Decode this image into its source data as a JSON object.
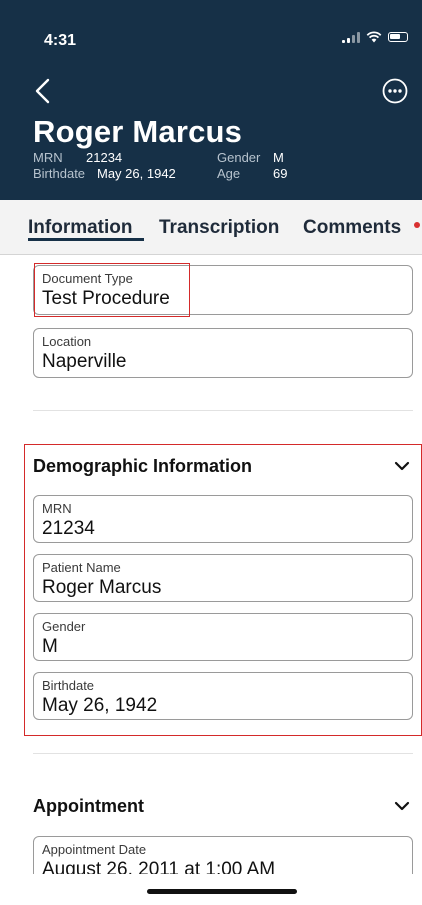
{
  "status_bar": {
    "time": "4:31"
  },
  "header": {
    "patient_name": "Roger Marcus",
    "mrn_label": "MRN",
    "mrn_value": "21234",
    "gender_label": "Gender",
    "gender_value": "M",
    "birthdate_label": "Birthdate",
    "birthdate_value": "May 26, 1942",
    "age_label": "Age",
    "age_value": "69"
  },
  "tabs": [
    {
      "label": "Information",
      "selected": true
    },
    {
      "label": "Transcription",
      "selected": false
    },
    {
      "label": "Comments",
      "selected": false,
      "badge": true
    }
  ],
  "fields_top": [
    {
      "label": "Document Type",
      "value": "Test Procedure"
    },
    {
      "label": "Location",
      "value": "Naperville"
    }
  ],
  "demographic": {
    "title": "Demographic Information",
    "fields": [
      {
        "label": "MRN",
        "value": "21234"
      },
      {
        "label": "Patient Name",
        "value": "Roger Marcus"
      },
      {
        "label": "Gender",
        "value": "M"
      },
      {
        "label": "Birthdate",
        "value": "May 26, 1942"
      }
    ]
  },
  "appointment": {
    "title": "Appointment",
    "fields": [
      {
        "label": "Appointment Date",
        "value": "August 26, 2011 at 1:00 AM"
      }
    ]
  },
  "colors": {
    "header_bg": "#163047",
    "highlight": "#d42a2a",
    "badge": "#d93030"
  },
  "icons": [
    "back-chevron-icon",
    "more-options-icon",
    "chevron-down-icon",
    "signal-icon",
    "wifi-icon",
    "battery-icon"
  ]
}
